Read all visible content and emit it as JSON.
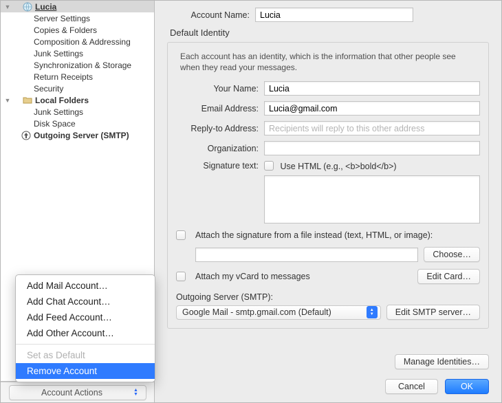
{
  "sidebar": {
    "account_name": "Lucia",
    "items": [
      "Server Settings",
      "Copies & Folders",
      "Composition & Addressing",
      "Junk Settings",
      "Synchronization & Storage",
      "Return Receipts",
      "Security"
    ],
    "local_name": "Local Folders",
    "local_items": [
      "Junk Settings",
      "Disk Space"
    ],
    "outgoing": "Outgoing Server (SMTP)",
    "actions_label": "Account Actions"
  },
  "menu": {
    "add_mail": "Add Mail Account…",
    "add_chat": "Add Chat Account…",
    "add_feed": "Add Feed Account…",
    "add_other": "Add Other Account…",
    "set_default": "Set as Default",
    "remove": "Remove Account"
  },
  "main": {
    "account_name_label": "Account Name:",
    "account_name_value": "Lucia",
    "identity_legend": "Default Identity",
    "identity_hint": "Each account has an identity, which is the information that other people see when they read your messages.",
    "your_name_label": "Your Name:",
    "your_name_value": "Lucia",
    "email_label": "Email Address:",
    "email_value": "Lucia@gmail.com",
    "reply_label": "Reply-to Address:",
    "reply_placeholder": "Recipients will reply to this other address",
    "org_label": "Organization:",
    "sig_label": "Signature text:",
    "use_html_label": "Use HTML (e.g., <b>bold</b>)",
    "attach_sig_label": "Attach the signature from a file instead (text, HTML, or image):",
    "choose_btn": "Choose…",
    "attach_vcard_label": "Attach my vCard to messages",
    "edit_card_btn": "Edit Card…",
    "out_server_label": "Outgoing Server (SMTP):",
    "out_server_value": "Google Mail - smtp.gmail.com (Default)",
    "edit_smtp_btn": "Edit SMTP server…",
    "manage_btn": "Manage Identities…",
    "cancel_btn": "Cancel",
    "ok_btn": "OK"
  }
}
